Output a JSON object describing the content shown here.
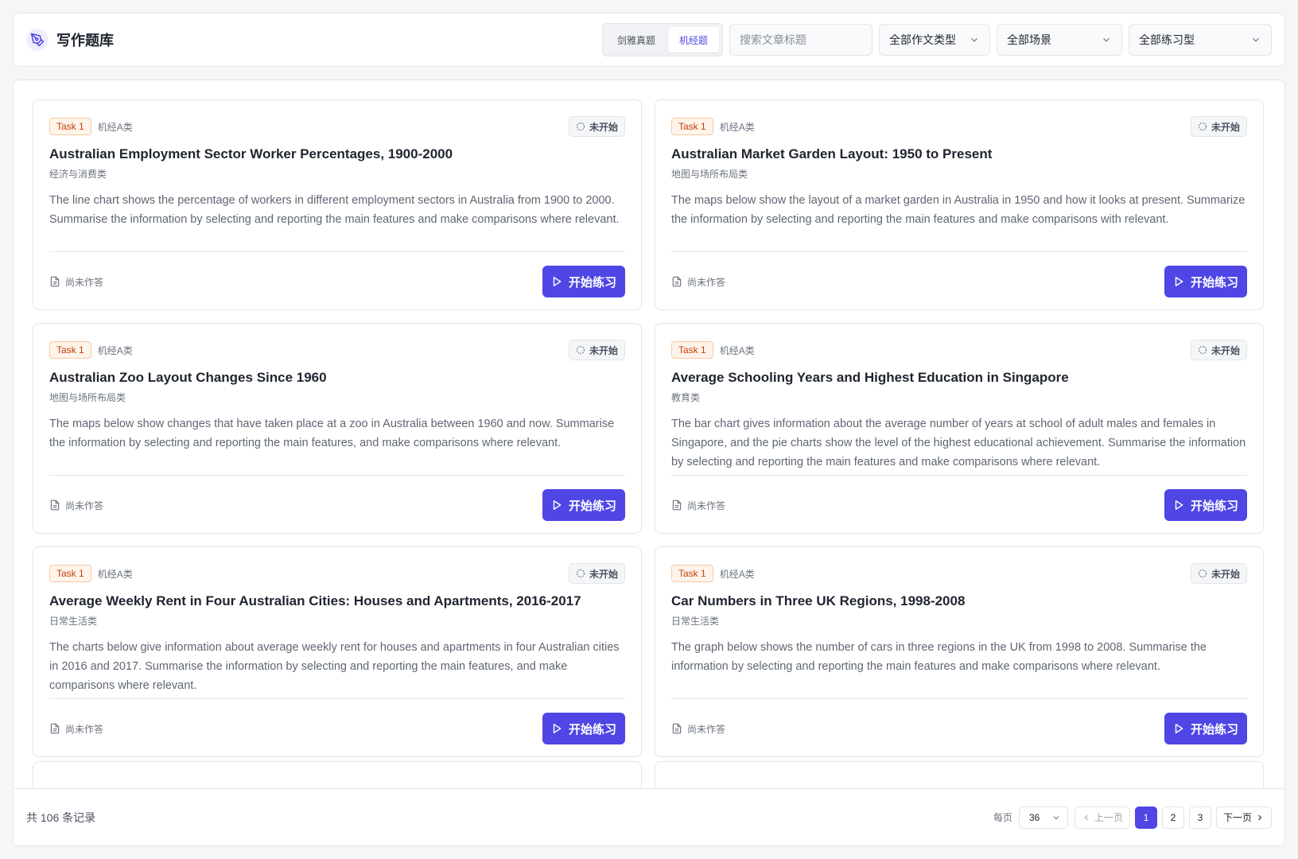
{
  "header": {
    "title": "写作题库",
    "tabs": [
      {
        "label": "剑雅真题",
        "active": false
      },
      {
        "label": "机经题",
        "active": true
      }
    ],
    "search_placeholder": "搜索文章标题",
    "filters": {
      "essay_type": "全部作文类型",
      "scene": "全部场景",
      "practice_type": "全部练习型"
    }
  },
  "colors": {
    "accent": "#4f46e5",
    "task_badge": "#c2410c"
  },
  "cards": [
    {
      "task": "Task 1",
      "source": "机经A类",
      "status": "未开始",
      "title": "Australian Employment Sector Worker Percentages, 1900-2000",
      "category": "经济与消费类",
      "description": "The line chart shows the percentage of workers in different employment sectors in Australia from 1900 to 2000. Summarise the information by selecting and reporting the main features and make comparisons where relevant.",
      "answer_status": "尚未作答",
      "button": "开始练习"
    },
    {
      "task": "Task 1",
      "source": "机经A类",
      "status": "未开始",
      "title": "Australian Market Garden Layout: 1950 to Present",
      "category": "地图与场所布局类",
      "description": "The maps below show the layout of a market garden in Australia in 1950 and how it looks at present. Summarize the information by selecting and reporting the main features and make comparisons with relevant.",
      "answer_status": "尚未作答",
      "button": "开始练习"
    },
    {
      "task": "Task 1",
      "source": "机经A类",
      "status": "未开始",
      "title": "Australian Zoo Layout Changes Since 1960",
      "category": "地图与场所布局类",
      "description": "The maps below show changes that have taken place at a zoo in Australia between 1960 and now. Summarise the information by selecting and reporting the main features, and make comparisons where relevant.",
      "answer_status": "尚未作答",
      "button": "开始练习"
    },
    {
      "task": "Task 1",
      "source": "机经A类",
      "status": "未开始",
      "title": "Average Schooling Years and Highest Education in Singapore",
      "category": "教育类",
      "description": "The bar chart gives information about the average number of years at school of adult males and females in Singapore, and the pie charts show the level of the highest educational achievement. Summarise the information by selecting and reporting the main features and make comparisons where relevant.",
      "answer_status": "尚未作答",
      "button": "开始练习"
    },
    {
      "task": "Task 1",
      "source": "机经A类",
      "status": "未开始",
      "title": "Average Weekly Rent in Four Australian Cities: Houses and Apartments, 2016-2017",
      "category": "日常生活类",
      "description": "The charts below give information about average weekly rent for houses and apartments in four Australian cities in 2016 and 2017. Summarise the information by selecting and reporting the main features, and make comparisons where relevant.",
      "answer_status": "尚未作答",
      "button": "开始练习"
    },
    {
      "task": "Task 1",
      "source": "机经A类",
      "status": "未开始",
      "title": "Car Numbers in Three UK Regions, 1998-2008",
      "category": "日常生活类",
      "description": "The graph below shows the number of cars in three regions in the UK from 1998 to 2008. Summarise the information by selecting and reporting the main features and make comparisons where relevant.",
      "answer_status": "尚未作答",
      "button": "开始练习"
    }
  ],
  "footer": {
    "total": "共 106 条记录",
    "per_page_label": "每页",
    "per_page_value": "36",
    "prev": "上一页",
    "next": "下一页",
    "pages": [
      "1",
      "2",
      "3"
    ],
    "current_page": "1"
  }
}
